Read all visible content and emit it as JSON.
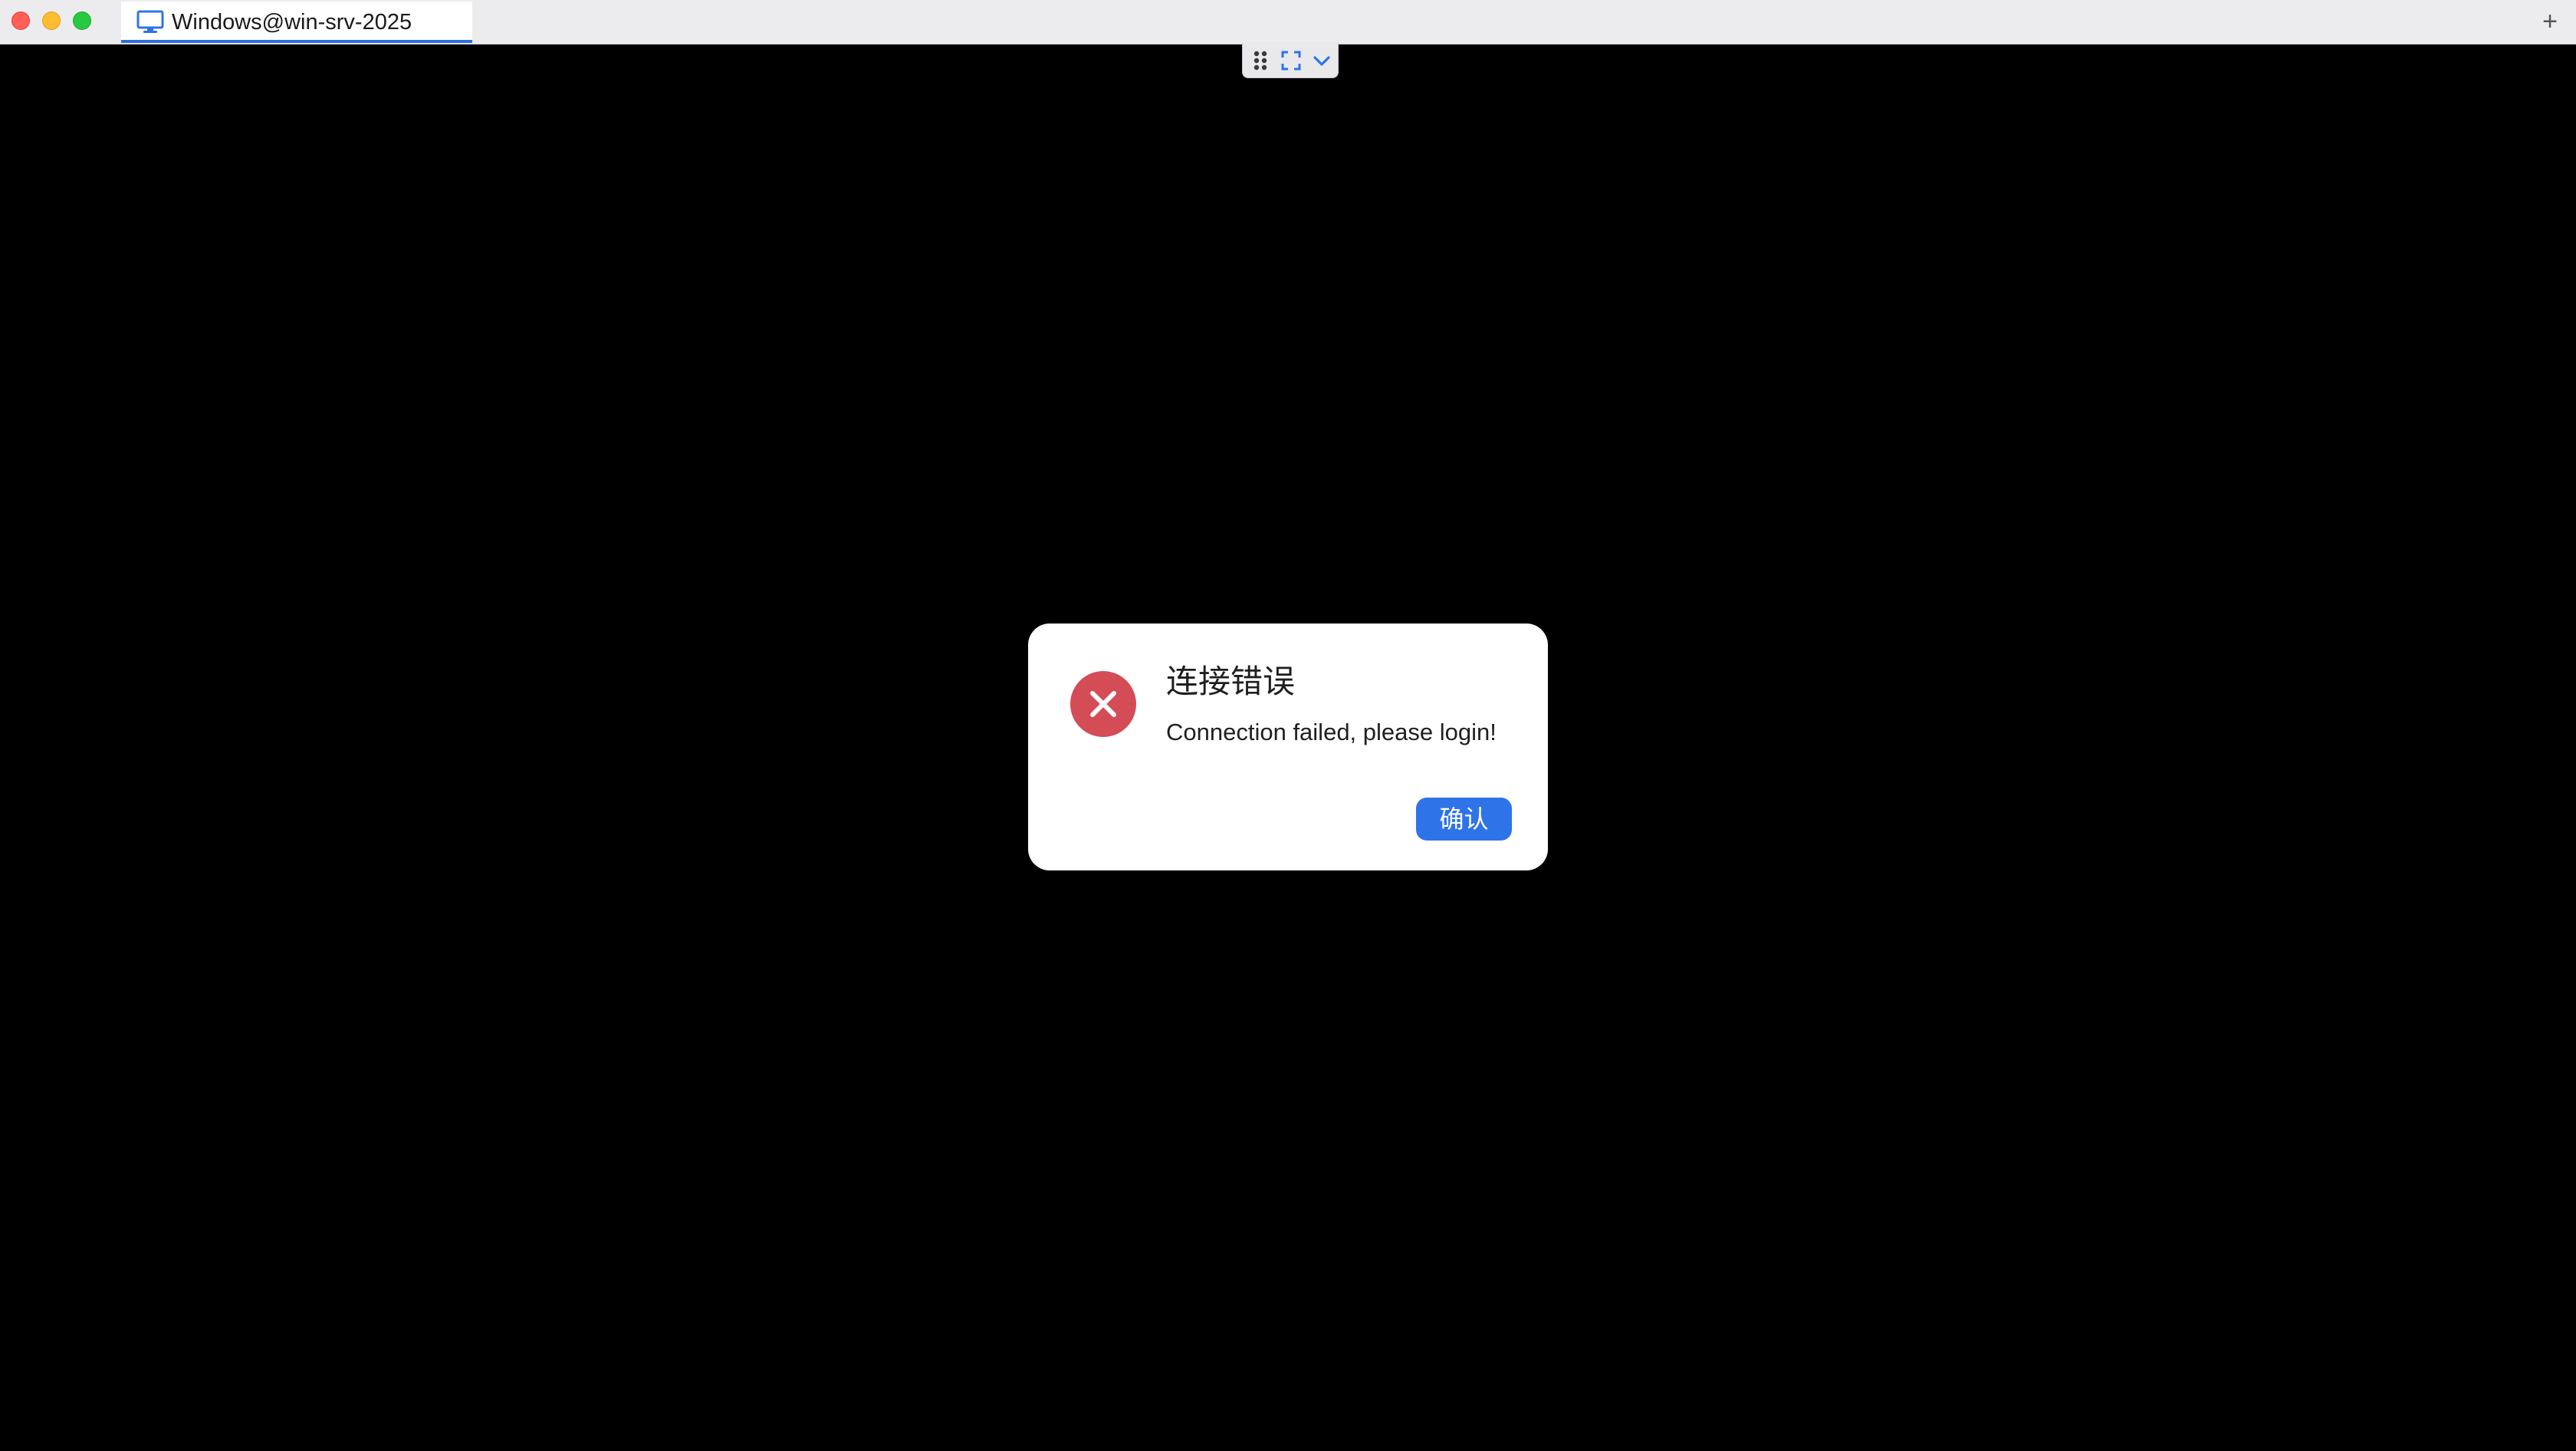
{
  "window": {
    "tab_title": "Windows@win-srv-2025",
    "tab_icon": "monitor-icon",
    "new_tab_label": "+"
  },
  "toolbar": {
    "icons": [
      "grip-icon",
      "fullscreen-icon",
      "chevron-down-icon"
    ]
  },
  "dialog": {
    "title": "连接错误",
    "message": "Connection failed, please login!",
    "confirm_label": "确认",
    "icon": "error-icon"
  },
  "colors": {
    "accent": "#2f73e8",
    "error": "#d44c56",
    "background": "#000000"
  }
}
